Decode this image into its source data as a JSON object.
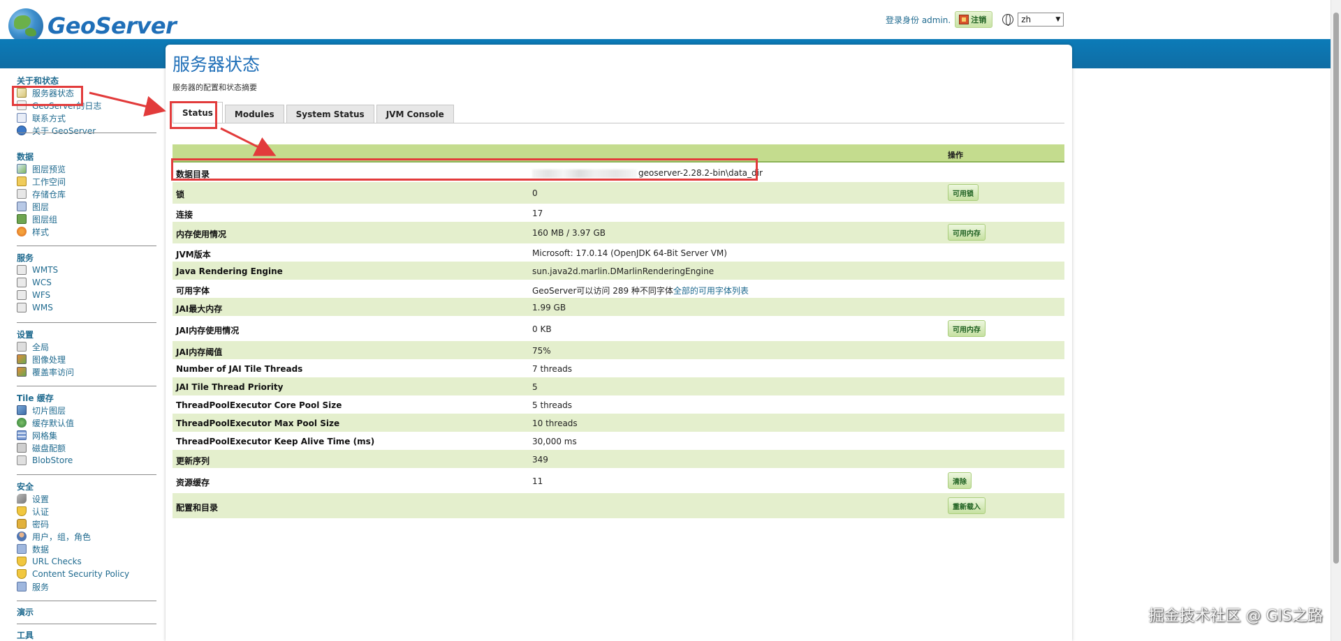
{
  "brand": {
    "name": "GeoServer"
  },
  "header": {
    "login_text": "登录身份 admin.",
    "logout_label": "注销",
    "language": "zh"
  },
  "sidebar": {
    "sections": [
      {
        "title": "关于和状态",
        "items": [
          "服务器状态",
          "GeoServer的日志",
          "联系方式",
          "关于 GeoServer"
        ]
      },
      {
        "title": "数据",
        "items": [
          "图层预览",
          "工作空间",
          "存储仓库",
          "图层",
          "图层组",
          "样式"
        ]
      },
      {
        "title": "服务",
        "items": [
          "WMTS",
          "WCS",
          "WFS",
          "WMS"
        ]
      },
      {
        "title": "设置",
        "items": [
          "全局",
          "图像处理",
          "覆盖率访问"
        ]
      },
      {
        "title": "Tile 缓存",
        "items": [
          "切片图层",
          "缓存默认值",
          "网格集",
          "磁盘配额",
          "BlobStore"
        ]
      },
      {
        "title": "安全",
        "items": [
          "设置",
          "认证",
          "密码",
          "用户，组，角色",
          "数据",
          "URL Checks",
          "Content Security Policy",
          "服务"
        ]
      },
      {
        "title": "演示",
        "items": []
      },
      {
        "title": "工具",
        "items": []
      }
    ]
  },
  "page": {
    "title": "服务器状态",
    "subtitle": "服务器的配置和状态摘要",
    "tabs": [
      "Status",
      "Modules",
      "System Status",
      "JVM Console"
    ],
    "table_header_op": "操作",
    "rows": [
      {
        "name": "数据目录",
        "value": "geoserver-2.28.2-bin\\data_dir",
        "op": ""
      },
      {
        "name": "锁",
        "value": "0",
        "op": "可用锁"
      },
      {
        "name": "连接",
        "value": "17",
        "op": ""
      },
      {
        "name": "内存使用情况",
        "value": "160 MB / 3.97 GB",
        "op": "可用内存"
      },
      {
        "name": "JVM版本",
        "value": "Microsoft: 17.0.14 (OpenJDK 64-Bit Server VM)",
        "op": ""
      },
      {
        "name": "Java Rendering Engine",
        "value": "sun.java2d.marlin.DMarlinRenderingEngine",
        "op": ""
      },
      {
        "name": "可用字体",
        "value": "GeoServer可以访问 289 种不同字体",
        "link": "全部的可用字体列表",
        "op": ""
      },
      {
        "name": "JAI最大内存",
        "value": "1.99 GB",
        "op": ""
      },
      {
        "name": "JAI内存使用情况",
        "value": "0 KB",
        "op": "可用内存"
      },
      {
        "name": "JAI内存阈值",
        "value": "75%",
        "op": ""
      },
      {
        "name": "Number of JAI Tile Threads",
        "value": "7 threads",
        "op": ""
      },
      {
        "name": "JAI Tile Thread Priority",
        "value": "5",
        "op": ""
      },
      {
        "name": "ThreadPoolExecutor Core Pool Size",
        "value": "5 threads",
        "op": ""
      },
      {
        "name": "ThreadPoolExecutor Max Pool Size",
        "value": "10 threads",
        "op": ""
      },
      {
        "name": "ThreadPoolExecutor Keep Alive Time (ms)",
        "value": "30,000 ms",
        "op": ""
      },
      {
        "name": "更新序列",
        "value": "349",
        "op": ""
      },
      {
        "name": "资源缓存",
        "value": "11",
        "op": "清除"
      },
      {
        "name": "配置和目录",
        "value": "",
        "op": "重新载入"
      }
    ]
  },
  "watermark": "掘金技术社区 @ GIS之路",
  "colors": {
    "accent_blue": "#0c7bb8",
    "highlight_red": "#e23b3b",
    "row_green": "#e4efcd"
  }
}
